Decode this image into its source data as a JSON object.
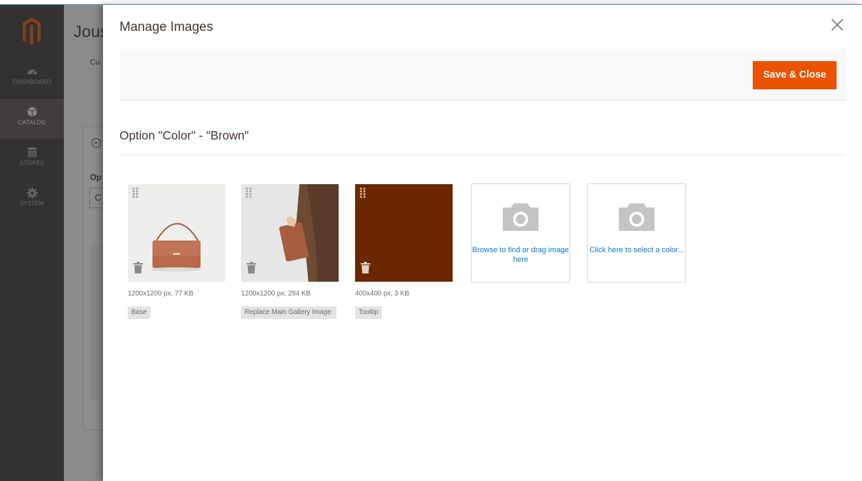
{
  "sidebar": {
    "items": [
      {
        "label": "DASHBOARD",
        "icon": "dashboard-icon",
        "active": false
      },
      {
        "label": "CATALOG",
        "icon": "catalog-box-icon",
        "active": true
      },
      {
        "label": "STORES",
        "icon": "stores-icon",
        "active": false
      },
      {
        "label": "SYSTEM",
        "icon": "gear-icon",
        "active": false
      }
    ]
  },
  "background_page": {
    "title": "Jous",
    "breadcrumb": "Cu",
    "option_label": "Op",
    "select_value": "C"
  },
  "modal": {
    "title": "Manage Images",
    "save_label": "Save & Close",
    "option_heading": "Option \"Color\" - \"Brown\"",
    "images": [
      {
        "meta": "1200x1200 px, 77 KB",
        "role": "Base"
      },
      {
        "meta": "1200x1200 px, 284 KB",
        "role": "Replace Main Gallery Image"
      },
      {
        "meta": "400x400 px, 3 KB",
        "role": "Tooltip"
      }
    ],
    "browse_text": "Browse to find or drag image here",
    "color_text": "Click here to select a color..."
  },
  "colors": {
    "accent": "#eb5202",
    "link": "#007bdb",
    "sidebar": "#373330",
    "swatch_brown": "#6b2800"
  }
}
